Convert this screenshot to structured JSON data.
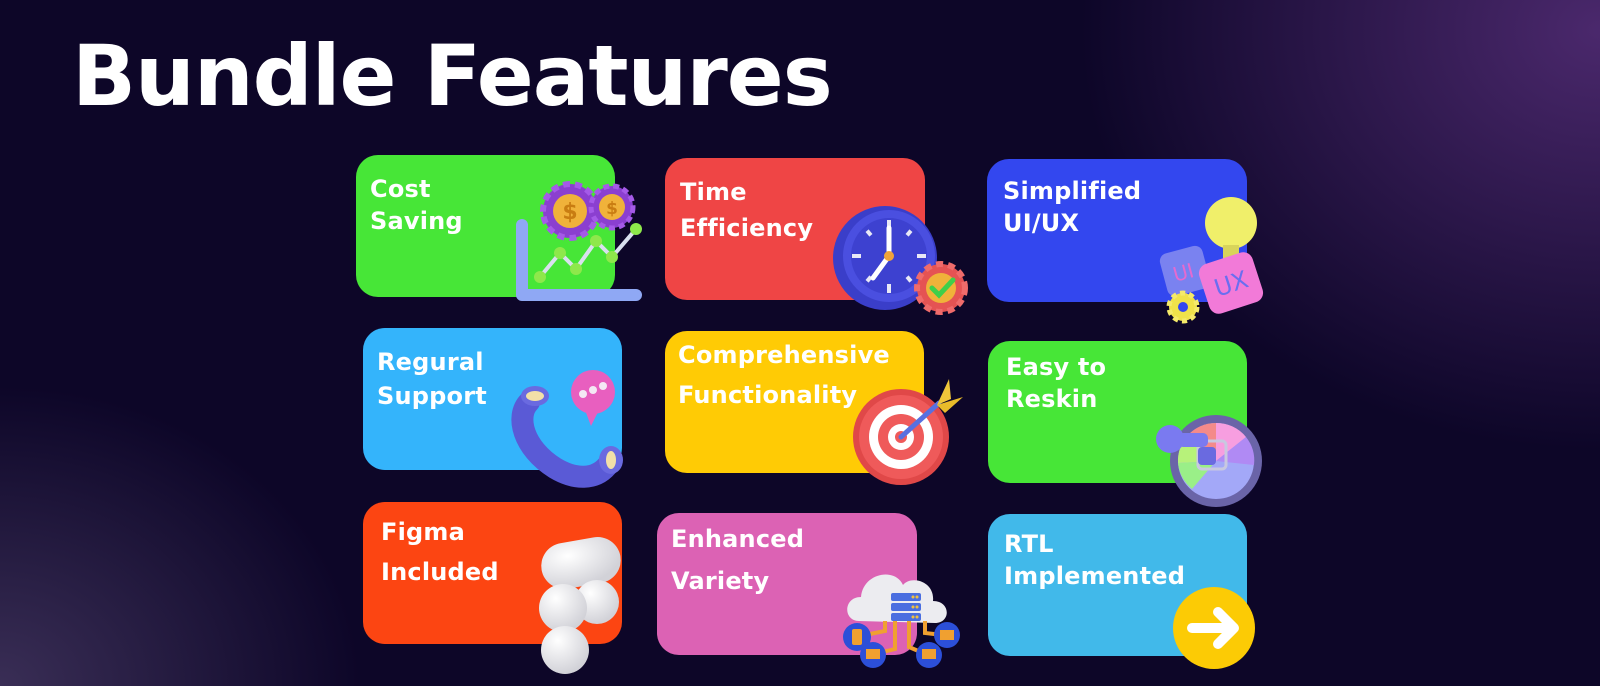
{
  "title": "Bundle Features",
  "cards": [
    {
      "line1": "Cost",
      "line2": "Saving",
      "color": "#47e637",
      "icon": "coins-chart-icon"
    },
    {
      "line1": "Time",
      "line2": "Efficiency",
      "color": "#ef4545",
      "icon": "clock-gear-icon"
    },
    {
      "line1": "Simplified",
      "line2": "UI/UX",
      "color": "#3347ef",
      "icon": "ui-ux-bulb-icon",
      "badge_ui": "UI",
      "badge_ux": "UX"
    },
    {
      "line1": "Regural",
      "line2": "Support",
      "color": "#34b4fb",
      "icon": "phone-chat-icon"
    },
    {
      "line1": "Comprehensive",
      "line2": "Functionality",
      "color": "#ffcb05",
      "icon": "target-dart-icon"
    },
    {
      "line1": "Easy to",
      "line2": "Reskin",
      "color": "#47e637",
      "icon": "color-wheel-icon"
    },
    {
      "line1": "Figma",
      "line2": "Included",
      "color": "#fc4512",
      "icon": "figma-logo-icon"
    },
    {
      "line1": "Enhanced",
      "line2": "Variety",
      "color": "#dc62b4",
      "icon": "cloud-devices-icon"
    },
    {
      "line1": "RTL",
      "line2": "Implemented",
      "color": "#41b9ea",
      "icon": "arrow-right-icon"
    }
  ]
}
